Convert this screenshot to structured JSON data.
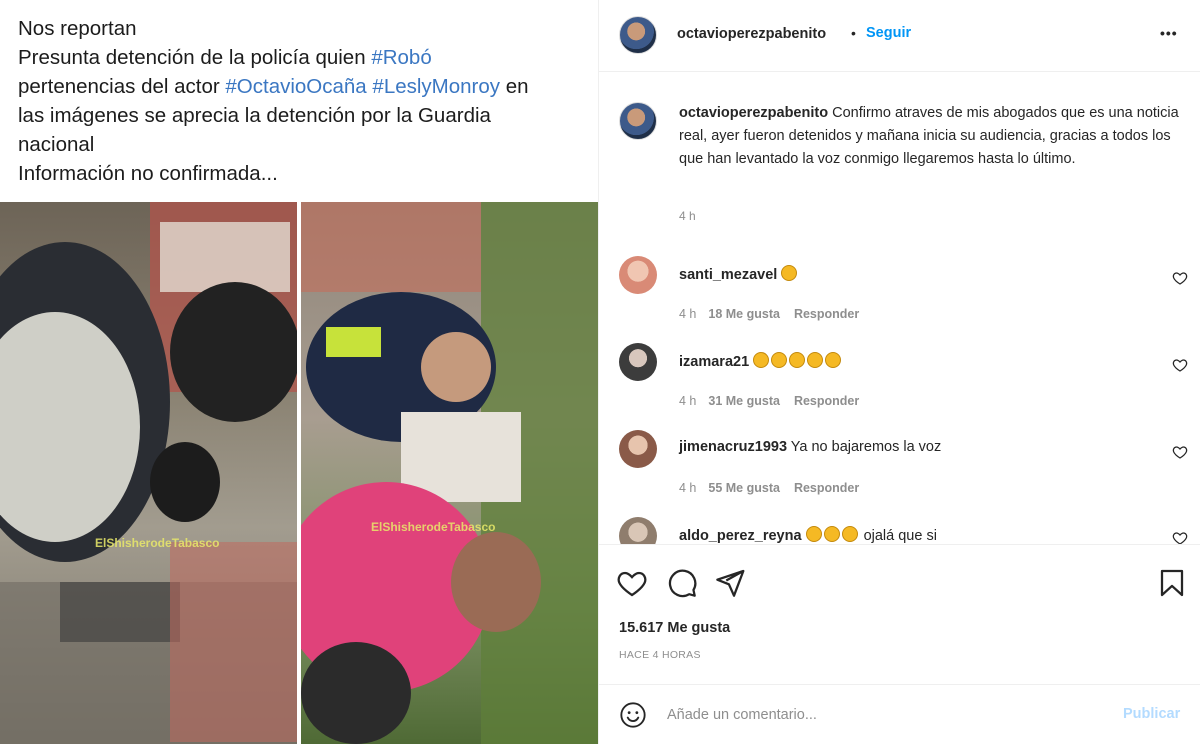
{
  "post_image": {
    "caption_lines": [
      "Nos reportan",
      "Presunta detención de la policía quien ",
      "#Robó",
      "pertenencias del actor ",
      "#OctavioOcaña",
      "#LeslyMonroy",
      " en",
      "las imágenes se aprecia la detención por la Guardia",
      "nacional",
      "Información no confirmada..."
    ],
    "watermark_left": "ElShisherodeTabasco",
    "watermark_right": "ElShisherodeTabasco"
  },
  "header": {
    "username": "octavioperezpabenito",
    "dot": "•",
    "follow_label": "Seguir",
    "more_icon": "more-horizontal-icon",
    "more_label": "•••"
  },
  "caption": {
    "username": "octavioperezpabenito",
    "text": " Confirmo atraves de mis abogados que es una noticia real, ayer fueron detenidos y mañana inicia su audiencia, gracias a todos los que han levantado la voz conmigo llegaremos hasta lo último.",
    "time": "4 h"
  },
  "comments": [
    {
      "username": "santi_mezavel",
      "text": "",
      "emoji_count": 1,
      "time": "4 h",
      "likes": "18 Me gusta",
      "reply": "Responder",
      "avatar_color": "#e8b8a8"
    },
    {
      "username": "izamara21",
      "text": "",
      "emoji_count": 5,
      "time": "4 h",
      "likes": "31 Me gusta",
      "reply": "Responder",
      "avatar_color": "#5b5b5b"
    },
    {
      "username": "jimenacruz1993",
      "text": "Ya no bajaremos la voz",
      "emoji_count": 0,
      "time": "4 h",
      "likes": "55 Me gusta",
      "reply": "Responder",
      "avatar_color": "#b07a62"
    },
    {
      "username": "aldo_perez_reyna",
      "text": " ojalá que si",
      "emoji_count": 3,
      "time": "",
      "likes": "",
      "reply": "",
      "avatar_color": "#a89a8a"
    }
  ],
  "actions": {
    "like_icon": "heart-icon",
    "comment_icon": "comment-icon",
    "share_icon": "share-icon",
    "save_icon": "bookmark-icon",
    "likes_count": "15.617 Me gusta",
    "posted": "HACE 4 HORAS"
  },
  "add_comment": {
    "placeholder": "Añade un comentario...",
    "publish_label": "Publicar",
    "publish_color": "#b3dbff"
  },
  "colors": {
    "accent": "#0095f6",
    "hashtag": "#3b77c2",
    "muted": "#8e8e8e"
  }
}
